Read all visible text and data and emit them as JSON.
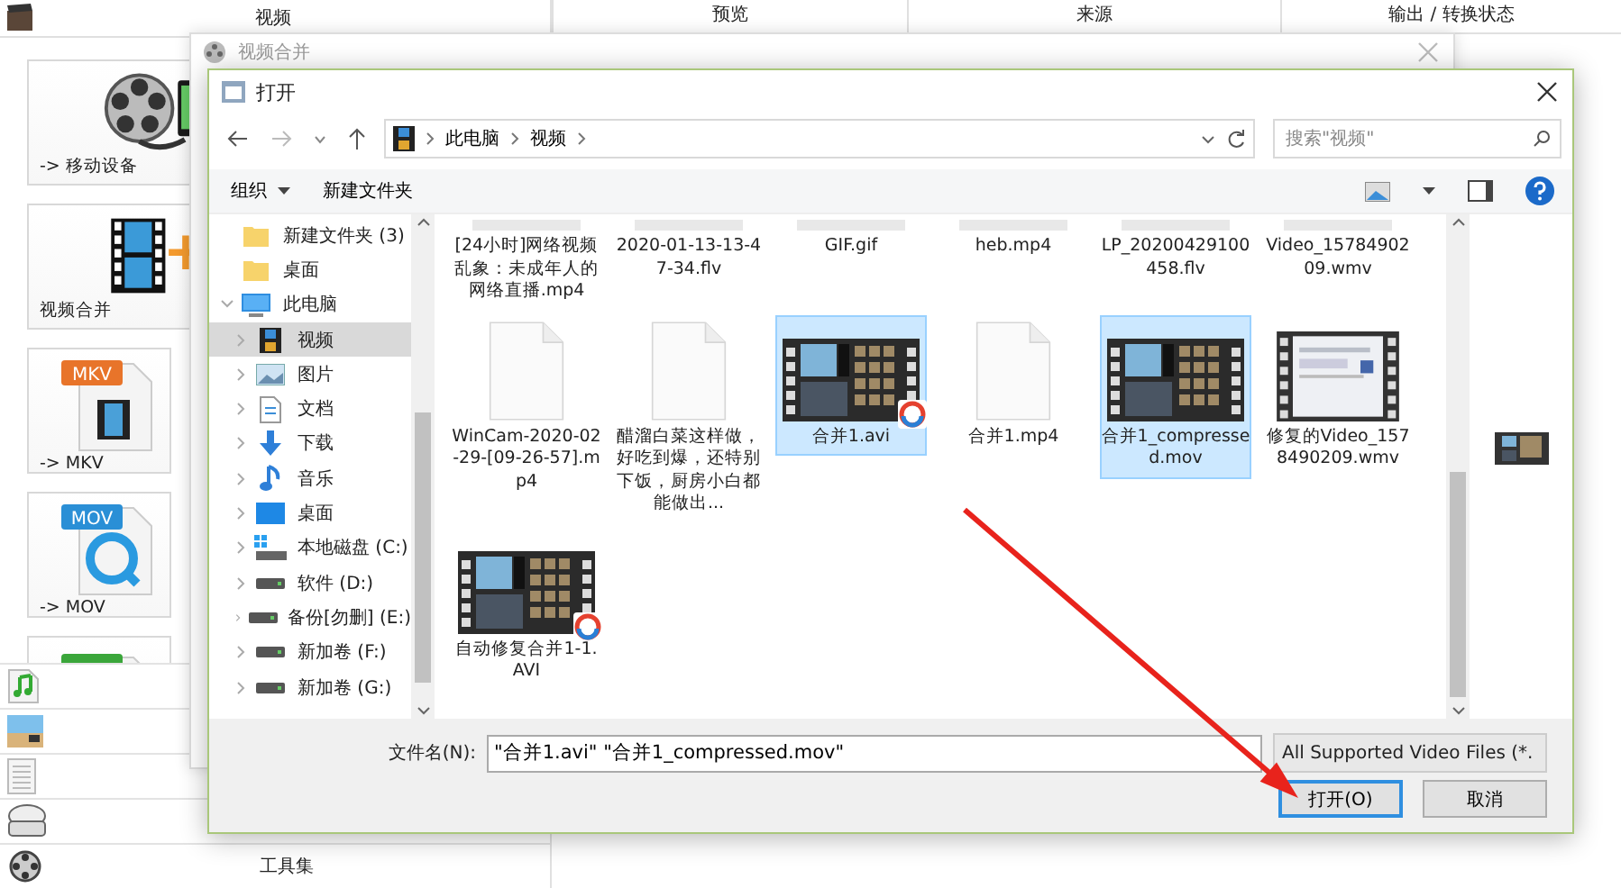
{
  "app": {
    "header_title": "视频",
    "columns": [
      "预览",
      "来源",
      "输出 / 转换状态"
    ],
    "tiles": [
      {
        "label": "-> 移动设备"
      },
      {
        "label": "视频合并"
      },
      {
        "label": "-> MKV",
        "badge": "MKV",
        "color": "#e8742a"
      },
      {
        "label": "-> MOV",
        "badge": "MOV",
        "color": "#2a8fd6"
      },
      {
        "color": "#3aa63a"
      }
    ],
    "categories": [
      {
        "label": "工具集"
      }
    ]
  },
  "merge_window": {
    "title": "视频合并"
  },
  "open_dialog": {
    "title": "打开",
    "breadcrumb": [
      "此电脑",
      "视频"
    ],
    "search": {
      "placeholder": "搜索\"视频\""
    },
    "toolbar": {
      "organize": "组织",
      "new_folder": "新建文件夹"
    },
    "nav": [
      {
        "label": "新建文件夹 (3)",
        "selected": false
      },
      {
        "label": "桌面",
        "selected": false
      },
      {
        "label": "此电脑",
        "selected": false,
        "expanded": true,
        "children": [
          {
            "label": "视频",
            "selected": true,
            "expanded": false
          },
          {
            "label": "图片",
            "selected": false,
            "expanded": false
          },
          {
            "label": "文档",
            "selected": false,
            "expanded": false
          },
          {
            "label": "下载",
            "selected": false,
            "expanded": false
          },
          {
            "label": "音乐",
            "selected": false,
            "expanded": false
          },
          {
            "label": "桌面",
            "selected": false,
            "expanded": false
          },
          {
            "label": "本地磁盘 (C:)",
            "selected": false,
            "expanded": false
          },
          {
            "label": "软件 (D:)",
            "selected": false,
            "expanded": false
          },
          {
            "label": "备份[勿删] (E:)",
            "selected": false,
            "expanded": false
          },
          {
            "label": "新加卷 (F:)",
            "selected": false,
            "expanded": false
          },
          {
            "label": "新加卷 (G:)",
            "selected": false,
            "expanded": false
          }
        ]
      }
    ],
    "files": [
      {
        "name": "[24小时]网络视频乱象：未成年人的网络直播.mp4",
        "kind": "clipped",
        "selected": false
      },
      {
        "name": "2020-01-13-13-47-34.flv",
        "kind": "clipped",
        "selected": false
      },
      {
        "name": "GIF.gif",
        "kind": "clipped",
        "selected": false
      },
      {
        "name": "heb.mp4",
        "kind": "clipped",
        "selected": false
      },
      {
        "name": "LP_20200429100458.flv",
        "kind": "clipped",
        "selected": false
      },
      {
        "name": "Video_1578490209.wmv",
        "kind": "clipped",
        "selected": false
      },
      {
        "name": "WinCam-2020-02-29-[09-26-57].mp4",
        "kind": "blank",
        "selected": false
      },
      {
        "name": "醋溜白菜这样做，好吃到爆，还特别下饭，厨房小白都能做出...",
        "kind": "blank",
        "selected": false
      },
      {
        "name": "合并1.avi",
        "kind": "badged",
        "selected": true
      },
      {
        "name": "合并1.mp4",
        "kind": "blank",
        "selected": false
      },
      {
        "name": "合并1_compressed.mov",
        "kind": "video",
        "selected": true
      },
      {
        "name": "修复的Video_1578490209.wmv",
        "kind": "screen",
        "selected": false
      },
      {
        "name": "自动修复合并1-1.AVI",
        "kind": "badged",
        "selected": false
      }
    ],
    "filename": {
      "label": "文件名(N):",
      "value": "\"合并1.avi\" \"合并1_compressed.mov\""
    },
    "file_type": "All Supported Video Files (*.",
    "buttons": [
      {
        "label": "打开(O)",
        "default": true
      },
      {
        "label": "取消",
        "default": false
      }
    ]
  }
}
